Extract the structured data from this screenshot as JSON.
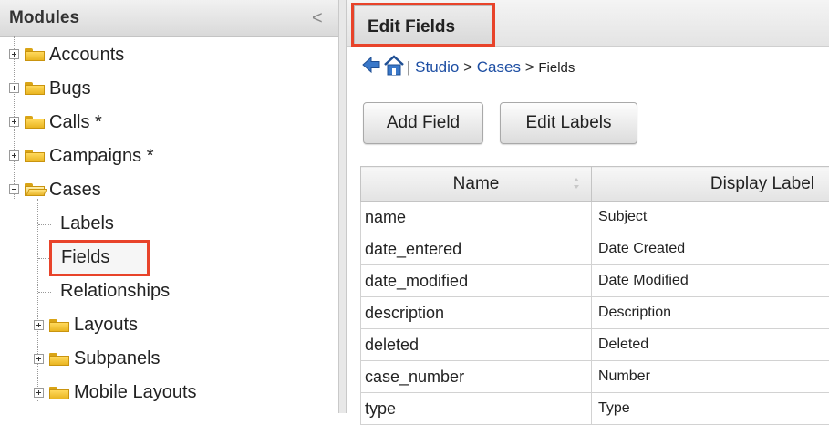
{
  "left_panel": {
    "title": "Modules",
    "collapse_glyph": "<",
    "items": [
      {
        "label": "Accounts"
      },
      {
        "label": "Bugs"
      },
      {
        "label": "Calls *"
      },
      {
        "label": "Campaigns *"
      },
      {
        "label": "Cases"
      }
    ],
    "cases_children": [
      {
        "label": "Labels"
      },
      {
        "label": "Fields"
      },
      {
        "label": "Relationships"
      },
      {
        "label": "Layouts"
      },
      {
        "label": "Subpanels"
      },
      {
        "label": "Mobile Layouts"
      }
    ]
  },
  "tab": {
    "label": "Edit Fields"
  },
  "breadcrumb": {
    "separator_lead": "|",
    "studio": "Studio",
    "sep1": ">",
    "module": "Cases",
    "sep2": ">",
    "current": "Fields"
  },
  "toolbar": {
    "add_field": "Add Field",
    "edit_labels": "Edit Labels"
  },
  "grid": {
    "columns": [
      "Name",
      "Display Label"
    ],
    "rows": [
      [
        "name",
        "Subject"
      ],
      [
        "date_entered",
        "Date Created"
      ],
      [
        "date_modified",
        "Date Modified"
      ],
      [
        "description",
        "Description"
      ],
      [
        "deleted",
        "Deleted"
      ],
      [
        "case_number",
        "Number"
      ],
      [
        "type",
        "Type"
      ]
    ]
  },
  "colors": {
    "highlight": "#e8432a",
    "link": "#1d4ea3",
    "folder": "#f0c33a"
  },
  "icons": [
    "back-arrow-icon",
    "home-icon",
    "folder-icon",
    "folder-open-icon",
    "expand-plus-icon",
    "collapse-minus-icon",
    "sort-icon",
    "chevron-left-icon"
  ]
}
